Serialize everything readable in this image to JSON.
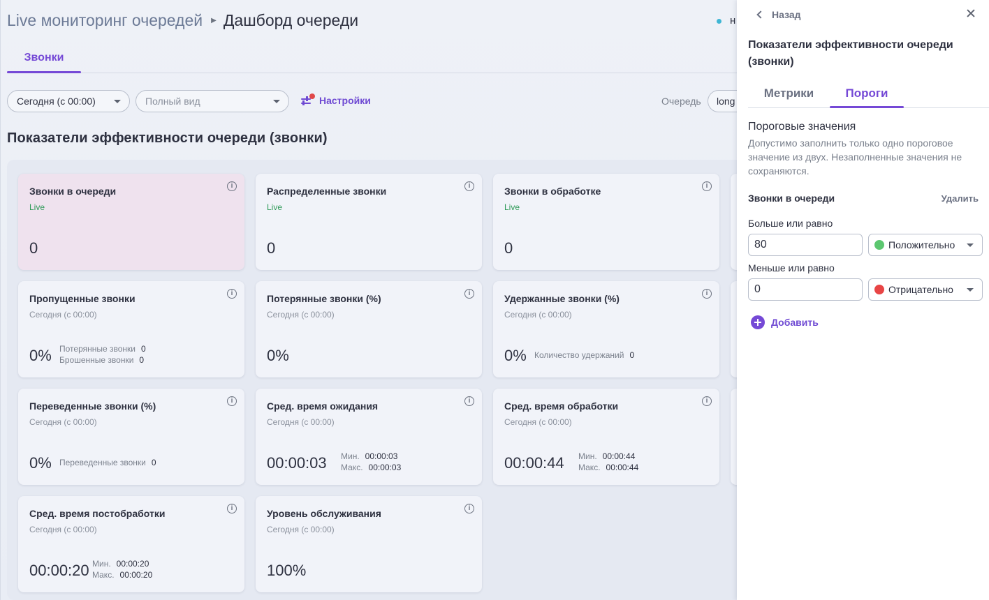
{
  "header": {
    "breadcrumb_root": "Live мониторинг очередей",
    "breadcrumb_current": "Дашборд очереди",
    "status_partial": "н"
  },
  "tabs": {
    "calls": "Звонки"
  },
  "toolbar": {
    "period": "Сегодня (с 00:00)",
    "view_placeholder": "Полный вид",
    "settings": "Настройки",
    "queue_label": "Очередь",
    "queue_value": "long"
  },
  "section_title": "Показатели эффективности очереди (звонки)",
  "cards": [
    {
      "title": "Звонки в очереди",
      "sub": "Live",
      "value": "0"
    },
    {
      "title": "Распределенные звонки",
      "sub": "Live",
      "value": "0"
    },
    {
      "title": "Звонки в обработке",
      "sub": "Live",
      "value": "0"
    },
    {
      "title": "Пропущенные звонки",
      "sub": "Сегодня (с 00:00)",
      "value": "0%",
      "details": [
        {
          "label": "Потерянные звонки",
          "value": "0"
        },
        {
          "label": "Брошенные звонки",
          "value": "0"
        }
      ]
    },
    {
      "title": "Потерянные звонки (%)",
      "sub": "Сегодня (с 00:00)",
      "value": "0%"
    },
    {
      "title": "Удержанные звонки (%)",
      "sub": "Сегодня (с 00:00)",
      "value": "0%",
      "details": [
        {
          "label": "Количество удержаний",
          "value": "0"
        }
      ]
    },
    {
      "title": "Переведенные звонки (%)",
      "sub": "Сегодня (с 00:00)",
      "value": "0%",
      "details": [
        {
          "label": "Переведенные звонки",
          "value": "0"
        }
      ]
    },
    {
      "title": "Сред. время ожидания",
      "sub": "Сегодня (с 00:00)",
      "value": "00:00:03",
      "details": [
        {
          "label": "Мин.",
          "value": "00:00:03"
        },
        {
          "label": "Макс.",
          "value": "00:00:03"
        }
      ]
    },
    {
      "title": "Сред. время обработки",
      "sub": "Сегодня (с 00:00)",
      "value": "00:00:44",
      "details": [
        {
          "label": "Мин.",
          "value": "00:00:44"
        },
        {
          "label": "Макс.",
          "value": "00:00:44"
        }
      ]
    },
    {
      "title": "Сред. время постобработки",
      "sub": "Сегодня (с 00:00)",
      "value": "00:00:20",
      "details": [
        {
          "label": "Мин.",
          "value": "00:00:20"
        },
        {
          "label": "Макс.",
          "value": "00:00:20"
        }
      ]
    },
    {
      "title": "Уровень обслуживания",
      "sub": "Сегодня (с 00:00)",
      "value": "100%"
    }
  ],
  "info_glyph": "i",
  "panel": {
    "back": "Назад",
    "title": "Показатели эффективности очереди (звонки)",
    "tab_metrics": "Метрики",
    "tab_thresholds": "Пороги",
    "thresholds_title": "Пороговые значения",
    "thresholds_desc": "Допустимо заполнить только одно пороговое значение из двух. Незаполненные значения не сохраняются.",
    "metric_name": "Звонки в очереди",
    "delete": "Удалить",
    "gte_label": "Больше или равно",
    "gte_value": "80",
    "gte_status": "Положительно",
    "gte_color": "#5cc770",
    "lte_label": "Меньше или равно",
    "lte_value": "0",
    "lte_status": "Отрицательно",
    "lte_color": "#e84545",
    "add": "Добавить"
  }
}
